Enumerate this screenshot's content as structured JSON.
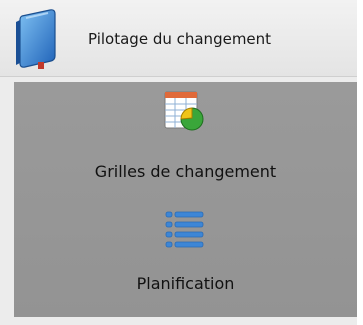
{
  "header": {
    "title": "Pilotage du changement",
    "icon": "book-icon"
  },
  "nav": {
    "items": [
      {
        "id": "grilles",
        "label": "Grilles de changement",
        "icon": "grid-chart-icon"
      },
      {
        "id": "planif",
        "label": "Planification",
        "icon": "list-icon"
      }
    ]
  },
  "colors": {
    "panel_background": "#969696",
    "header_background": "#ececec",
    "accent_blue": "#3d86d6"
  }
}
